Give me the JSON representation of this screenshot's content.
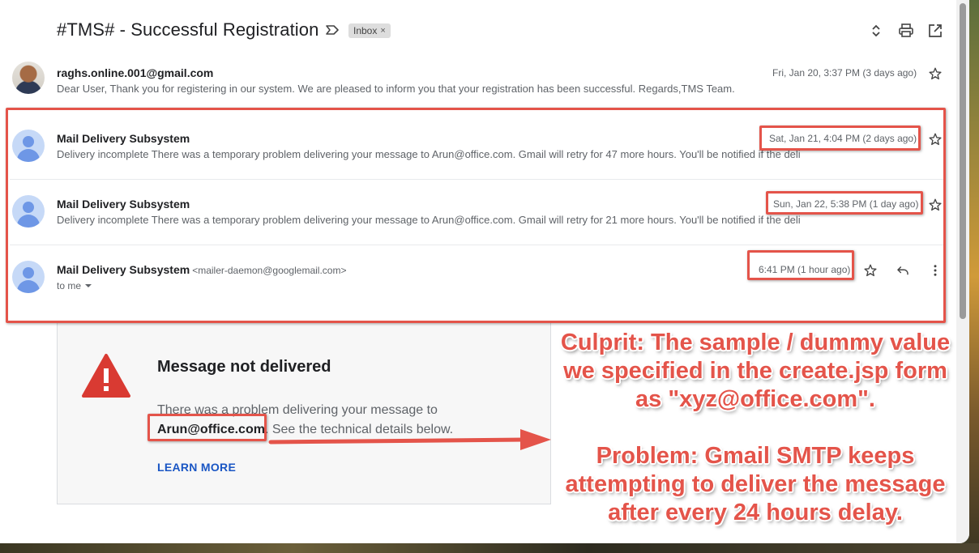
{
  "email": {
    "subject": "#TMS# - Successful Registration",
    "label_chip": "Inbox",
    "chip_close": "×"
  },
  "icons": {
    "label": "label-arrow-icon",
    "expand": "expand-collapse-icon",
    "print": "print-icon",
    "open_new": "open-in-new-window-icon",
    "star": "star-outline-icon",
    "reply": "reply-icon",
    "more": "more-vert-icon",
    "dropdown": "caret-down-icon",
    "warning": "warning-triangle-icon",
    "avatar": "default-avatar-icon"
  },
  "messages": [
    {
      "sender": "raghs.online.001@gmail.com",
      "snippet": "Dear User, Thank you for registering in our system. We are pleased to inform you that your registration has been successful. Regards,TMS Team.",
      "date": "Fri, Jan 20, 3:37 PM (3 days ago)"
    },
    {
      "sender": "Mail Delivery Subsystem",
      "snippet": "Delivery incomplete There was a temporary problem delivering your message to Arun@office.com. Gmail will retry for 47 more hours. You'll be notified if the deli",
      "date": "Sat, Jan 21, 4:04 PM (2 days ago)"
    },
    {
      "sender": "Mail Delivery Subsystem",
      "snippet": "Delivery incomplete There was a temporary problem delivering your message to Arun@office.com. Gmail will retry for 21 more hours. You'll be notified if the deli",
      "date": "Sun, Jan 22, 5:38 PM (1 day ago)"
    },
    {
      "sender": "Mail Delivery Subsystem",
      "sender_email": "<mailer-daemon@googlemail.com>",
      "recipient": "to me",
      "date": "6:41 PM (1 hour ago)"
    }
  ],
  "bounce": {
    "title": "Message not delivered",
    "text_before": "There was a problem delivering your message to",
    "address": "Arun@office.com",
    "text_after": ". See the technical details below.",
    "learn_more": "LEARN MORE"
  },
  "annotation": {
    "culprit_lines": [
      "Culprit: The sample / dummy value",
      "we specified in the create.jsp form",
      "as \"xyz@office.com\"."
    ],
    "problem_lines": [
      "Problem: Gmail SMTP keeps",
      "attempting to deliver the message",
      "after every 24 hours delay."
    ]
  },
  "colors": {
    "annotation_red": "#e4544a",
    "link_blue": "#1a56c4",
    "avatar_bg": "#c6d9f7",
    "avatar_fg": "#6e97e6",
    "warning_red": "#d93a32"
  }
}
